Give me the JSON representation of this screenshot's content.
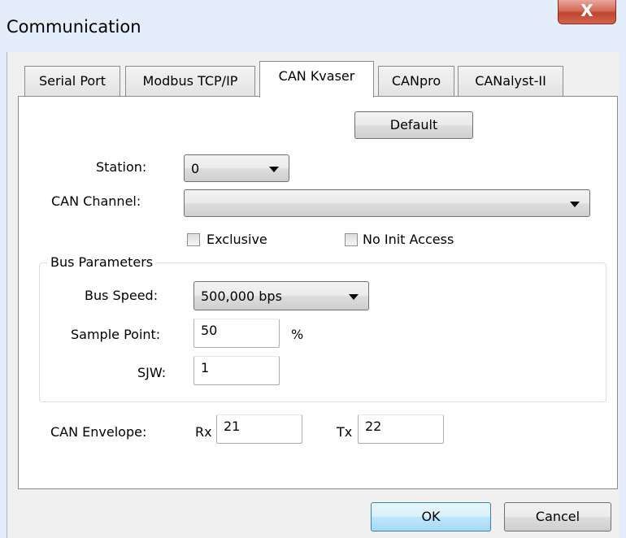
{
  "window": {
    "title": "Communication",
    "close_glyph": "X"
  },
  "tabs": [
    {
      "label": "Serial Port",
      "active": false
    },
    {
      "label": "Modbus TCP/IP",
      "active": false
    },
    {
      "label": "CAN Kvaser",
      "active": true
    },
    {
      "label": "CANpro",
      "active": false
    },
    {
      "label": "CANalyst-II",
      "active": false
    }
  ],
  "panel": {
    "default_button": "Default",
    "station": {
      "label": "Station:",
      "value": "0"
    },
    "can_channel": {
      "label": "CAN Channel:",
      "value": ""
    },
    "exclusive": {
      "label": "Exclusive",
      "checked": false
    },
    "no_init_access": {
      "label": "No Init Access",
      "checked": false
    },
    "bus_parameters": {
      "title": "Bus Parameters",
      "bus_speed": {
        "label": "Bus Speed:",
        "value": "500,000 bps"
      },
      "sample_point": {
        "label": "Sample Point:",
        "value": "50",
        "unit": "%"
      },
      "sjw": {
        "label": "SJW:",
        "value": "1"
      }
    },
    "can_envelope": {
      "label": "CAN Envelope:",
      "rx_label": "Rx",
      "rx_value": "21",
      "tx_label": "Tx",
      "tx_value": "22"
    }
  },
  "footer": {
    "ok": "OK",
    "cancel": "Cancel"
  },
  "icons": {
    "close": "close-icon",
    "dropdown": "chevron-down-icon"
  }
}
